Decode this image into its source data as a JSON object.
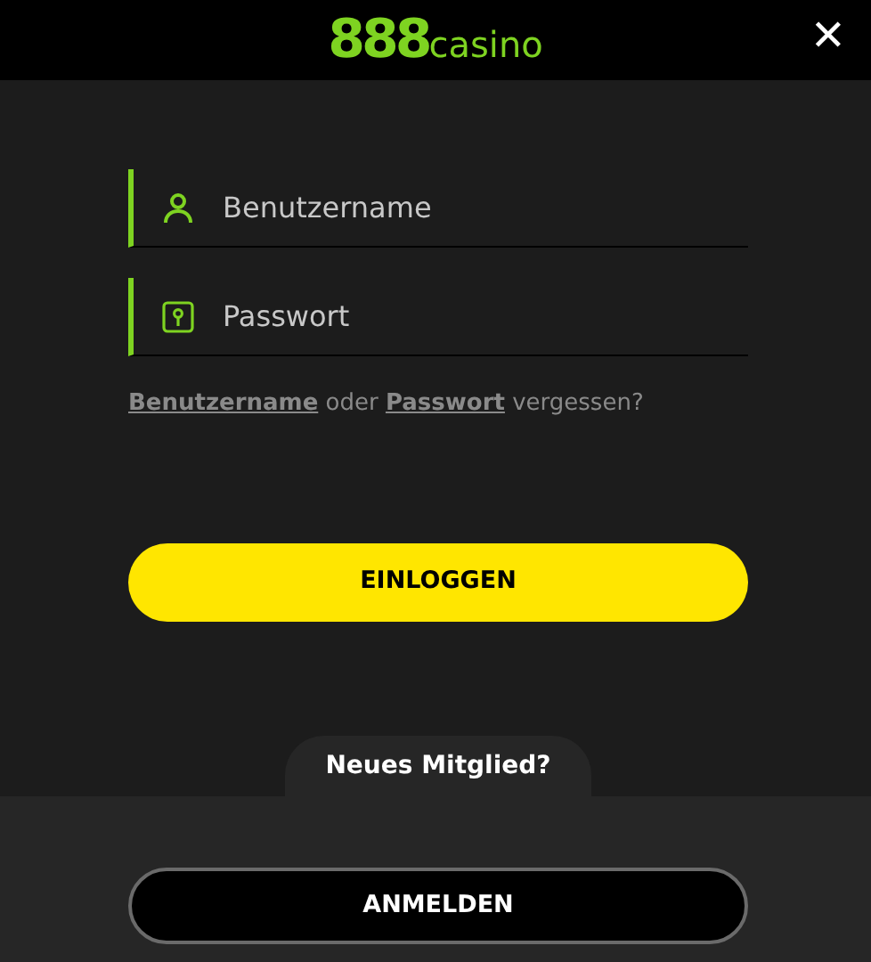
{
  "header": {
    "logo": {
      "digits": "888",
      "word": "casino"
    },
    "close": "✕"
  },
  "fields": [
    {
      "kind": "user",
      "placeholder": "Benutzername"
    },
    {
      "kind": "password",
      "placeholder": "Passwort"
    }
  ],
  "forgot": [
    {
      "kind": "link",
      "text": "Benutzername"
    },
    {
      "kind": "text",
      "text": " oder "
    },
    {
      "kind": "link",
      "text": "Passwort"
    },
    {
      "kind": "text",
      "text": " vergessen?"
    }
  ],
  "login_button": "EINLOGGEN",
  "new_member": {
    "tab": "Neues Mitglied?",
    "button": "ANMELDEN"
  }
}
